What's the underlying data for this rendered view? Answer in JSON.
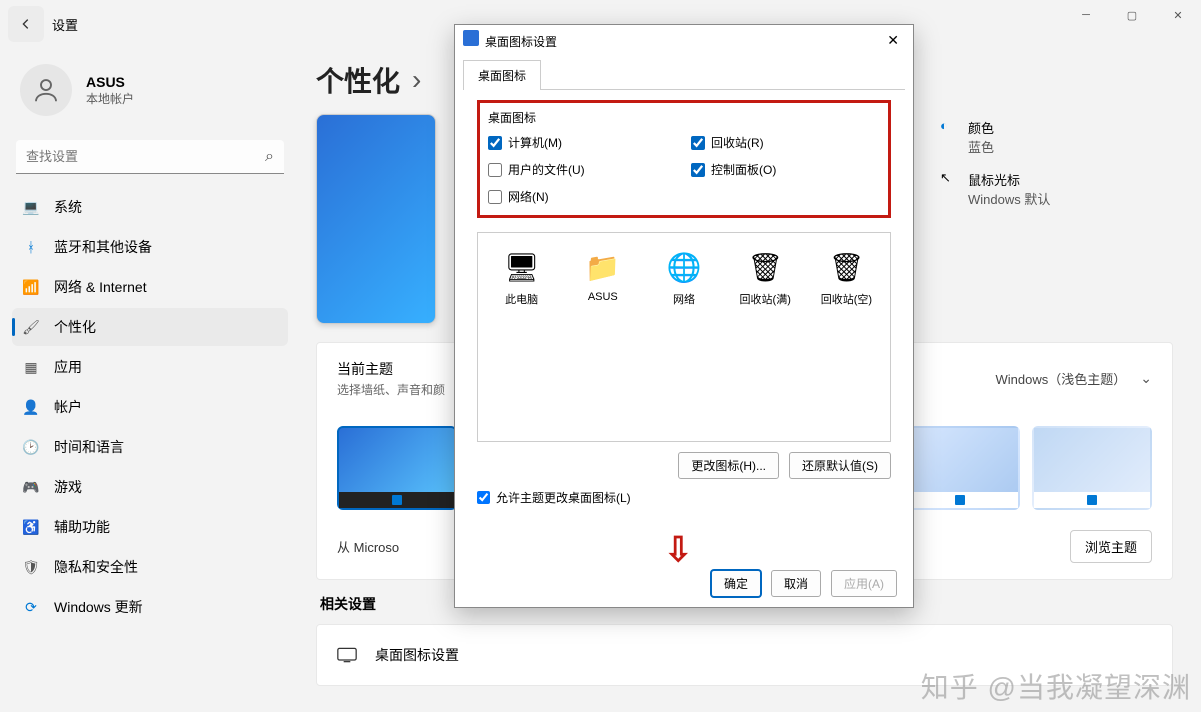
{
  "titlebar": {
    "title": "设置"
  },
  "user": {
    "name": "ASUS",
    "sub": "本地帐户"
  },
  "search": {
    "placeholder": "查找设置"
  },
  "nav": [
    {
      "icon": "💻",
      "label": "系统",
      "name": "nav-system"
    },
    {
      "icon": "ᚼ",
      "label": "蓝牙和其他设备",
      "name": "nav-bluetooth",
      "color": "#0078d4"
    },
    {
      "icon": "📶",
      "label": "网络 & Internet",
      "name": "nav-network",
      "color": "#0078d4"
    },
    {
      "icon": "🖌",
      "label": "个性化",
      "name": "nav-personalization",
      "active": true
    },
    {
      "icon": "▦",
      "label": "应用",
      "name": "nav-apps"
    },
    {
      "icon": "👤",
      "label": "帐户",
      "name": "nav-accounts"
    },
    {
      "icon": "🕑",
      "label": "时间和语言",
      "name": "nav-time"
    },
    {
      "icon": "🎮",
      "label": "游戏",
      "name": "nav-gaming"
    },
    {
      "icon": "♿",
      "label": "辅助功能",
      "name": "nav-accessibility"
    },
    {
      "icon": "🛡",
      "label": "隐私和安全性",
      "name": "nav-privacy"
    },
    {
      "icon": "⟳",
      "label": "Windows 更新",
      "name": "nav-update",
      "color": "#0078d4"
    }
  ],
  "breadcrumb": {
    "root": "个性化",
    "sep": "›"
  },
  "side_options": {
    "color": {
      "title": "颜色",
      "sub": "蓝色"
    },
    "cursor": {
      "title": "鼠标光标",
      "sub": "Windows 默认"
    }
  },
  "theme_card": {
    "title": "当前主题",
    "sub": "选择墙纸、声音和颜",
    "dropdown": "Windows（浅色主题）",
    "store_label": "从 Microso",
    "browse": "浏览主题"
  },
  "related": {
    "title": "相关设置",
    "row1": "桌面图标设置"
  },
  "dialog": {
    "title": "桌面图标设置",
    "tab": "桌面图标",
    "group_title": "桌面图标",
    "checks": {
      "computer": {
        "label": "计算机(M)",
        "checked": true
      },
      "userfiles": {
        "label": "用户的文件(U)",
        "checked": false
      },
      "network": {
        "label": "网络(N)",
        "checked": false
      },
      "recycle": {
        "label": "回收站(R)",
        "checked": true
      },
      "control": {
        "label": "控制面板(O)",
        "checked": true
      }
    },
    "icons": [
      {
        "label": "此电脑",
        "glyph": "🖥",
        "name": "icon-thispc"
      },
      {
        "label": "ASUS",
        "glyph": "📁",
        "name": "icon-userfolder"
      },
      {
        "label": "网络",
        "glyph": "🌐",
        "name": "icon-network"
      },
      {
        "label": "回收站(满)",
        "glyph": "🗑",
        "name": "icon-recycle-full"
      },
      {
        "label": "回收站(空)",
        "glyph": "🗑",
        "name": "icon-recycle-empty"
      }
    ],
    "change_icon": "更改图标(H)...",
    "restore": "还原默认值(S)",
    "allow": "允许主题更改桌面图标(L)",
    "ok": "确定",
    "cancel": "取消",
    "apply": "应用(A)"
  },
  "watermark": "知乎 @当我凝望深渊"
}
